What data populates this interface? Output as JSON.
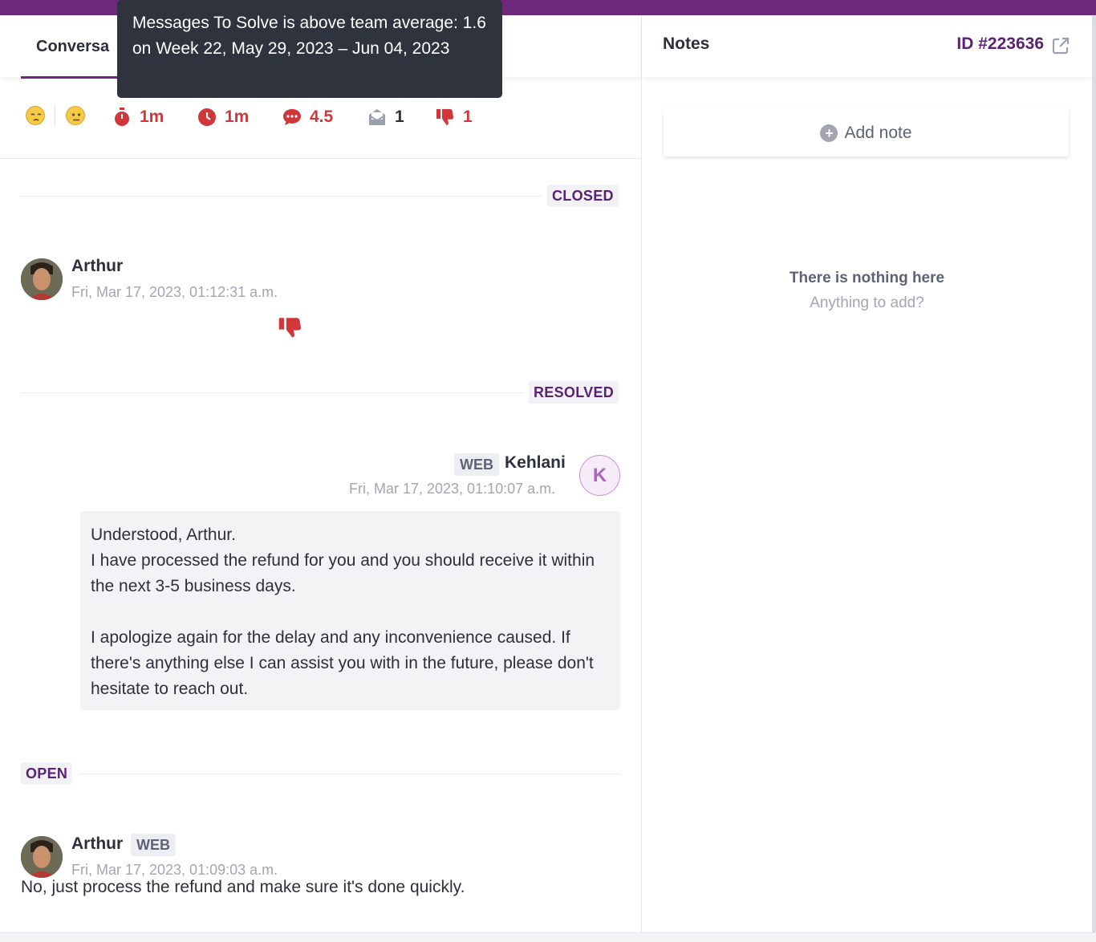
{
  "left": {
    "tab_conversation": "Conversa",
    "stats": {
      "first_response": "1m",
      "resolution_time": "1m",
      "messages_to_solve": "4.5",
      "reopens": "1",
      "negative_ratings": "1"
    },
    "tooltip": "Messages To Solve is above team average: 1.6 on Week 22, May 29, 2023 – Jun 04, 2023"
  },
  "conversation": {
    "status_closed": "CLOSED",
    "status_resolved": "RESOLVED",
    "status_open": "OPEN",
    "msg1": {
      "author": "Arthur",
      "time": "Fri, Mar 17, 2023, 01:12:31 a.m."
    },
    "msg2": {
      "channel": "WEB",
      "author": "Kehlani",
      "avatar_initial": "K",
      "time": "Fri, Mar 17, 2023, 01:10:07 a.m.",
      "body": "Understood, Arthur.\nI have processed the refund for you and you should receive it within the next 3-5 business days.\n\nI apologize again for the delay and any inconvenience caused. If there's anything else I can assist you with in the future, please don't hesitate to reach out."
    },
    "msg3": {
      "author": "Arthur",
      "channel": "WEB",
      "time": "Fri, Mar 17, 2023, 01:09:03 a.m.",
      "body": "No, just process the refund and make sure it's done quickly."
    }
  },
  "notes": {
    "title": "Notes",
    "ticket_id": "ID #223636",
    "add_note_label": "Add note",
    "empty_title": "There is nothing here",
    "empty_subtitle": "Anything to add?"
  },
  "colors": {
    "brand_purple": "#6e2a7a",
    "alert_red": "#d0373a"
  }
}
